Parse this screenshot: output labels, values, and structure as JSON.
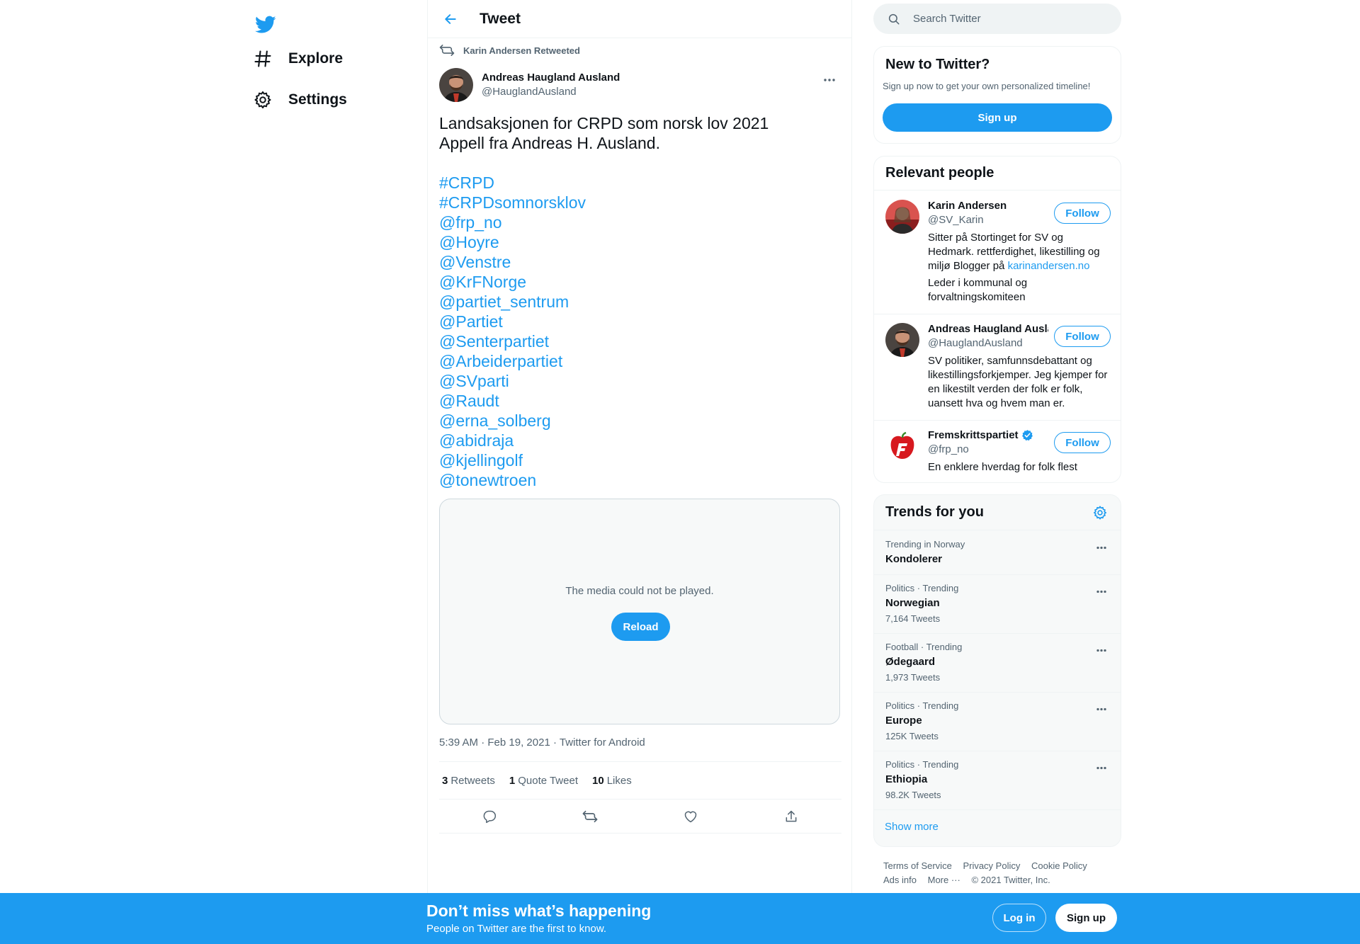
{
  "colors": {
    "accent": "#1d9bf0",
    "text": "#0f1419",
    "secondary": "#536471",
    "border": "#eff3f4",
    "panel": "#f7f9f9"
  },
  "nav": {
    "logo_icon": "twitter-bird-icon",
    "items": [
      {
        "label": "Explore",
        "icon": "hashtag-icon"
      },
      {
        "label": "Settings",
        "icon": "gear-icon"
      }
    ]
  },
  "main": {
    "header_title": "Tweet",
    "tweet": {
      "retweet_context": "Karin Andersen Retweeted",
      "author_name": "Andreas Haugland Ausland",
      "author_handle": "@HauglandAusland",
      "text_lines": [
        "Landsaksjonen for CRPD som norsk lov 2021",
        "Appell fra Andreas H. Ausland."
      ],
      "links": [
        "#CRPD",
        "#CRPDsomnorsklov",
        "@frp_no",
        "@Hoyre",
        "@Venstre",
        "@KrFNorge",
        "@partiet_sentrum",
        "@Partiet",
        "@Senterpartiet",
        "@Arbeiderpartiet",
        "@SVparti",
        "@Raudt",
        "@erna_solberg",
        "@abidraja",
        "@kjellingolf",
        "@tonewtroen"
      ],
      "media_message": "The media could not be played.",
      "reload_label": "Reload",
      "meta": {
        "time": "5:39 AM",
        "date": "Feb 19, 2021",
        "source": "Twitter for Android",
        "separator": "·"
      },
      "stats": [
        {
          "count": "3",
          "label": "Retweets"
        },
        {
          "count": "1",
          "label": "Quote Tweet"
        },
        {
          "count": "10",
          "label": "Likes"
        }
      ]
    }
  },
  "sidebar": {
    "search_placeholder": "Search Twitter",
    "new_to_twitter": {
      "title": "New to Twitter?",
      "subtitle": "Sign up now to get your own personalized timeline!",
      "button": "Sign up"
    },
    "relevant_people": {
      "title": "Relevant people",
      "follow_label": "Follow",
      "people": [
        {
          "name": "Karin Andersen",
          "handle": "@SV_Karin",
          "bio": "Sitter på Stortinget for SV og Hedmark. rettferdighet, likestilling og miljø Blogger på",
          "bio_link": "karinandersen.no",
          "bio2": "Leder i kommunal og forvaltningskomiteen"
        },
        {
          "name": "Andreas Haugland Ausland",
          "handle": "@HauglandAusland",
          "bio": "SV politiker, samfunnsdebattant og likestillingsforkjemper. Jeg kjemper for en likestilt verden der folk er folk, uansett hva og hvem man er."
        },
        {
          "name": "Fremskrittspartiet",
          "handle": "@frp_no",
          "bio": "En enklere hverdag for folk flest",
          "verified": true
        }
      ]
    },
    "trends": {
      "title": "Trends for you",
      "items": [
        {
          "context": "Trending in Norway",
          "name": "Kondolerer",
          "count": ""
        },
        {
          "context": "Politics · Trending",
          "name": "Norwegian",
          "count": "7,164 Tweets"
        },
        {
          "context": "Football · Trending",
          "name": "Ødegaard",
          "count": "1,973 Tweets"
        },
        {
          "context": "Politics · Trending",
          "name": "Europe",
          "count": "125K Tweets"
        },
        {
          "context": "Politics · Trending",
          "name": "Ethiopia",
          "count": "98.2K Tweets"
        }
      ],
      "show_more": "Show more"
    },
    "footer": {
      "links": [
        "Terms of Service",
        "Privacy Policy",
        "Cookie Policy",
        "Ads info",
        "More ···"
      ],
      "copyright": "© 2021 Twitter, Inc."
    }
  },
  "bottom_bar": {
    "title": "Don’t miss what’s happening",
    "subtitle": "People on Twitter are the first to know.",
    "login": "Log in",
    "signup": "Sign up"
  }
}
